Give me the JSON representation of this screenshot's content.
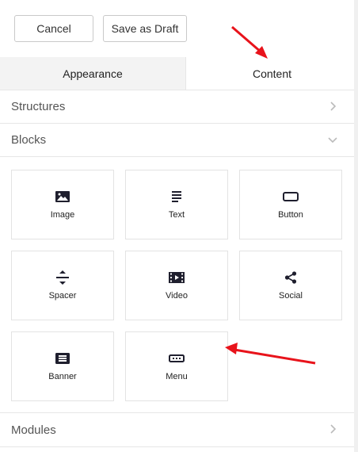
{
  "toolbar": {
    "cancel_label": "Cancel",
    "draft_label": "Save as Draft"
  },
  "tabs": [
    {
      "label": "Appearance"
    },
    {
      "label": "Content"
    }
  ],
  "sections": {
    "structures": "Structures",
    "blocks": "Blocks",
    "modules": "Modules"
  },
  "blocks": [
    {
      "label": "Image",
      "icon": "image-icon"
    },
    {
      "label": "Text",
      "icon": "text-icon"
    },
    {
      "label": "Button",
      "icon": "button-icon"
    },
    {
      "label": "Spacer",
      "icon": "spacer-icon"
    },
    {
      "label": "Video",
      "icon": "video-icon"
    },
    {
      "label": "Social",
      "icon": "share-icon"
    },
    {
      "label": "Banner",
      "icon": "banner-icon"
    },
    {
      "label": "Menu",
      "icon": "menu-icon"
    }
  ],
  "colors": {
    "annotation_arrow": "#e8131b",
    "active_tab": "#ffffff",
    "inactive_tab": "#f3f3f3",
    "icon": "#1f1f2e"
  }
}
